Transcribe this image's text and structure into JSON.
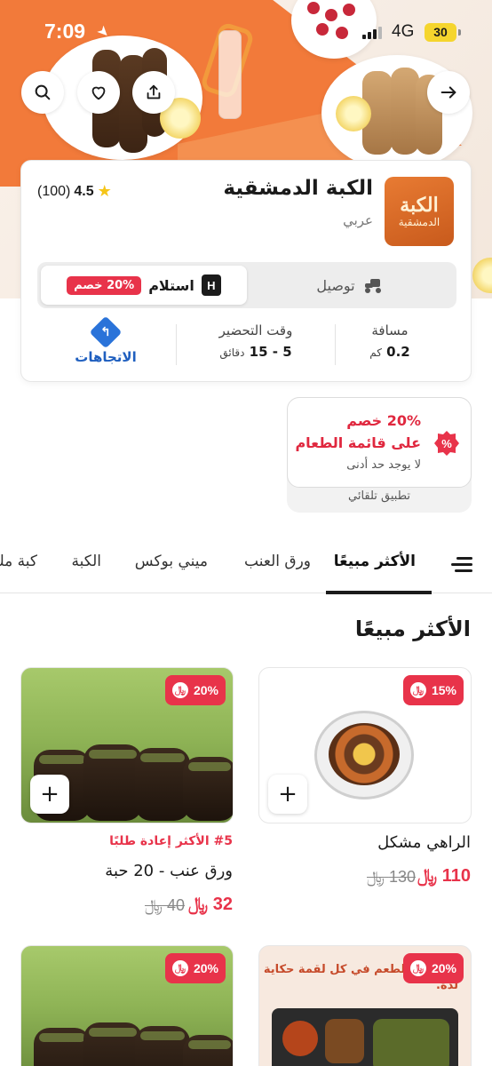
{
  "status_bar": {
    "time": "7:09",
    "network": "4G",
    "battery": "30"
  },
  "restaurant": {
    "name": "الكبة الدمشقية",
    "cuisine": "عربي",
    "rating": "4.5",
    "reviews": "(100)",
    "logo_line1": "الكبة",
    "logo_line2": "الدمشقية"
  },
  "mode_toggle": {
    "pickup_label": "استلام",
    "pickup_discount": "20% خصم",
    "delivery_label": "توصيل",
    "selected": "pickup"
  },
  "stats": {
    "distance_label": "مسافة",
    "distance_value": "0.2",
    "distance_unit": "كم",
    "prep_label": "وقت التحضير",
    "prep_value": "5 - 15",
    "prep_unit": "دقائق",
    "directions_label": "الاتجاهات"
  },
  "offer": {
    "line1": "20% خصم",
    "line2": "على قائمة الطعام",
    "line3": "لا يوجد حد أدنى",
    "footer": "تطبيق تلقائي"
  },
  "tabs": [
    "الأكثر مبيعًا",
    "ورق العنب",
    "ميني بوكس",
    "الكبة",
    "كبة مك"
  ],
  "active_tab": "الأكثر مبيعًا",
  "section_title": "الأكثر مبيعًا",
  "products": [
    {
      "name": "الراهي مشكل",
      "price": "110",
      "old_price": "130",
      "discount": "15%",
      "tag": ""
    },
    {
      "name": "ورق عنب - 20 حبة",
      "price": "32",
      "old_price": "40",
      "discount": "20%",
      "tag": "#5 الأكثر إعادة طلبًا"
    },
    {
      "name": "",
      "price": "",
      "old_price": "",
      "discount": "20%",
      "tag": "",
      "image_text": "استمتع بالطعم في كل لقمة حكاية لذة."
    },
    {
      "name": "",
      "price": "",
      "old_price": "",
      "discount": "20%",
      "tag": ""
    }
  ],
  "colors": {
    "accent": "#e8334a",
    "link": "#1f5fbf",
    "hero_orange": "#f27a3a"
  },
  "icons": [
    "back-arrow-icon",
    "share-icon",
    "heart-icon",
    "search-icon",
    "star-icon",
    "pickup-icon",
    "delivery-icon",
    "directions-icon",
    "percent-badge-icon",
    "menu-icon",
    "plus-icon",
    "riyal-icon"
  ]
}
